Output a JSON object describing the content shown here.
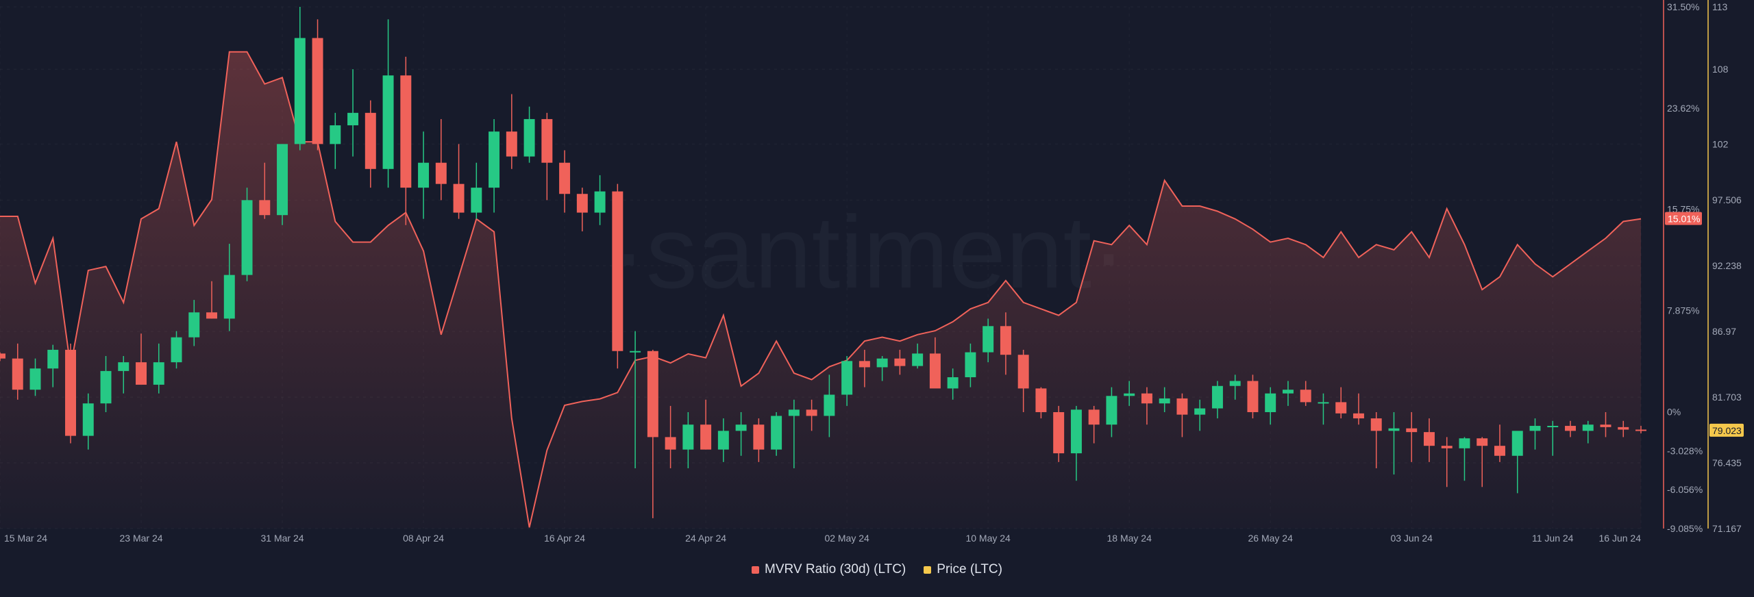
{
  "chart_data": {
    "type": "line",
    "title": "",
    "watermark": "·santiment·",
    "x_dates": [
      "15 Mar 24",
      "16 Mar 24",
      "17 Mar 24",
      "18 Mar 24",
      "19 Mar 24",
      "20 Mar 24",
      "21 Mar 24",
      "22 Mar 24",
      "23 Mar 24",
      "24 Mar 24",
      "25 Mar 24",
      "26 Mar 24",
      "27 Mar 24",
      "28 Mar 24",
      "29 Mar 24",
      "30 Mar 24",
      "31 Mar 24",
      "01 Apr 24",
      "02 Apr 24",
      "03 Apr 24",
      "04 Apr 24",
      "05 Apr 24",
      "06 Apr 24",
      "07 Apr 24",
      "08 Apr 24",
      "09 Apr 24",
      "10 Apr 24",
      "11 Apr 24",
      "12 Apr 24",
      "13 Apr 24",
      "14 Apr 24",
      "15 Apr 24",
      "16 Apr 24",
      "17 Apr 24",
      "18 Apr 24",
      "19 Apr 24",
      "20 Apr 24",
      "21 Apr 24",
      "22 Apr 24",
      "23 Apr 24",
      "24 Apr 24",
      "25 Apr 24",
      "26 Apr 24",
      "27 Apr 24",
      "28 Apr 24",
      "29 Apr 24",
      "30 Apr 24",
      "01 May 24",
      "02 May 24",
      "03 May 24",
      "04 May 24",
      "05 May 24",
      "06 May 24",
      "07 May 24",
      "08 May 24",
      "09 May 24",
      "10 May 24",
      "11 May 24",
      "12 May 24",
      "13 May 24",
      "14 May 24",
      "15 May 24",
      "16 May 24",
      "17 May 24",
      "18 May 24",
      "19 May 24",
      "20 May 24",
      "21 May 24",
      "22 May 24",
      "23 May 24",
      "24 May 24",
      "25 May 24",
      "26 May 24",
      "27 May 24",
      "28 May 24",
      "29 May 24",
      "30 May 24",
      "31 May 24",
      "01 Jun 24",
      "02 Jun 24",
      "03 Jun 24",
      "04 Jun 24",
      "05 Jun 24",
      "06 Jun 24",
      "07 Jun 24",
      "08 Jun 24",
      "09 Jun 24",
      "10 Jun 24",
      "11 Jun 24",
      "12 Jun 24",
      "13 Jun 24",
      "14 Jun 24",
      "15 Jun 24",
      "16 Jun 24"
    ],
    "x_tick_labels": [
      "15 Mar 24",
      "23 Mar 24",
      "31 Mar 24",
      "08 Apr 24",
      "16 Apr 24",
      "24 Apr 24",
      "02 May 24",
      "10 May 24",
      "18 May 24",
      "26 May 24",
      "03 Jun 24",
      "11 Jun 24",
      "16 Jun 24"
    ],
    "series": [
      {
        "name": "MVRV Ratio (30d) (LTC)",
        "color": "#f0625a",
        "axis": "left",
        "values": [
          15.2,
          15.2,
          10.0,
          13.5,
          3.5,
          11.0,
          11.3,
          8.5,
          15.0,
          15.8,
          21.0,
          14.5,
          16.5,
          28.0,
          28.0,
          25.5,
          26.0,
          21.0,
          21.0,
          14.8,
          13.2,
          13.2,
          14.5,
          15.5,
          12.5,
          6.0,
          10.5,
          15.0,
          14.0,
          -0.5,
          -9.0,
          -3.0,
          0.5,
          0.8,
          1.0,
          1.5,
          4.0,
          4.3,
          3.8,
          4.5,
          4.2,
          7.5,
          2.0,
          3.0,
          5.5,
          3.0,
          2.5,
          3.5,
          4.0,
          5.5,
          5.8,
          5.5,
          6.0,
          6.3,
          7.0,
          8.0,
          8.5,
          10.2,
          8.5,
          8.0,
          7.5,
          8.5,
          13.3,
          13.0,
          14.5,
          13.0,
          18.0,
          16.0,
          16.0,
          15.6,
          15.0,
          14.2,
          13.2,
          13.5,
          13.0,
          12.0,
          14.0,
          12.0,
          13.0,
          12.6,
          14.0,
          12.0,
          15.8,
          13.0,
          9.5,
          10.5,
          13.0,
          11.5,
          10.5,
          11.5,
          12.5,
          13.5,
          14.8,
          15.01
        ]
      },
      {
        "name": "Price (LTC)",
        "color": "#f5c84c",
        "axis": "right",
        "ohlc": [
          [
            85.2,
            85.3,
            84.6,
            84.8
          ],
          [
            84.8,
            86.0,
            81.5,
            82.3
          ],
          [
            82.3,
            84.8,
            81.8,
            84.0
          ],
          [
            84.0,
            85.9,
            82.5,
            85.5
          ],
          [
            85.5,
            86.0,
            78.0,
            78.6
          ],
          [
            78.6,
            82.0,
            77.5,
            81.2
          ],
          [
            81.2,
            85.0,
            80.5,
            83.8
          ],
          [
            83.8,
            85.0,
            82.0,
            84.5
          ],
          [
            84.5,
            86.8,
            83.0,
            82.7
          ],
          [
            82.7,
            86.0,
            82.0,
            84.5
          ],
          [
            84.5,
            87.0,
            84.0,
            86.5
          ],
          [
            86.5,
            89.5,
            85.8,
            88.5
          ],
          [
            88.5,
            91.0,
            88.0,
            88.0
          ],
          [
            88.0,
            94.0,
            87.0,
            91.5
          ],
          [
            91.5,
            98.5,
            91.0,
            97.5
          ],
          [
            97.5,
            100.5,
            96.0,
            96.3
          ],
          [
            96.3,
            99.0,
            95.5,
            102.0
          ],
          [
            102.0,
            113.0,
            101.5,
            110.5
          ],
          [
            110.5,
            112.0,
            101.5,
            102.0
          ],
          [
            102.0,
            104.5,
            100.0,
            103.5
          ],
          [
            103.5,
            108.0,
            101.0,
            104.5
          ],
          [
            104.5,
            105.5,
            98.5,
            100.0
          ],
          [
            100.0,
            112.0,
            98.5,
            107.5
          ],
          [
            107.5,
            109.0,
            95.5,
            98.5
          ],
          [
            98.5,
            103.0,
            96.0,
            100.5
          ],
          [
            100.5,
            104.0,
            97.5,
            98.8
          ],
          [
            98.8,
            102.0,
            96.0,
            96.5
          ],
          [
            96.5,
            100.5,
            96.0,
            98.5
          ],
          [
            98.5,
            104.0,
            96.5,
            103.0
          ],
          [
            103.0,
            106.0,
            100.0,
            101.0
          ],
          [
            101.0,
            105.0,
            100.5,
            104.0
          ],
          [
            104.0,
            104.5,
            97.5,
            100.5
          ],
          [
            100.5,
            101.5,
            96.5,
            98.0
          ],
          [
            98.0,
            98.5,
            95.0,
            96.5
          ],
          [
            96.5,
            99.5,
            95.5,
            98.2
          ],
          [
            98.2,
            98.8,
            84.0,
            85.4
          ],
          [
            85.4,
            87.0,
            76.0,
            85.4
          ],
          [
            85.4,
            85.5,
            72.0,
            78.5
          ],
          [
            78.5,
            81.0,
            76.0,
            77.5
          ],
          [
            77.5,
            80.5,
            76.0,
            79.5
          ],
          [
            79.5,
            81.5,
            77.5,
            77.5
          ],
          [
            77.5,
            80.0,
            76.5,
            79.0
          ],
          [
            79.0,
            80.5,
            77.0,
            79.5
          ],
          [
            79.5,
            80.0,
            76.5,
            77.5
          ],
          [
            77.5,
            80.5,
            77.0,
            80.2
          ],
          [
            80.2,
            81.5,
            76.0,
            80.7
          ],
          [
            80.7,
            81.5,
            79.0,
            80.2
          ],
          [
            80.2,
            83.5,
            78.5,
            81.9
          ],
          [
            81.9,
            85.0,
            81.0,
            84.6
          ],
          [
            84.6,
            85.5,
            82.5,
            84.1
          ],
          [
            84.1,
            85.0,
            83.0,
            84.8
          ],
          [
            84.8,
            85.5,
            83.5,
            84.2
          ],
          [
            84.2,
            86.0,
            84.0,
            85.2
          ],
          [
            85.2,
            86.5,
            84.5,
            82.4
          ],
          [
            82.4,
            84.0,
            81.5,
            83.3
          ],
          [
            83.3,
            86.0,
            82.5,
            85.3
          ],
          [
            85.3,
            88.0,
            84.5,
            87.4
          ],
          [
            87.4,
            88.5,
            83.5,
            85.1
          ],
          [
            85.1,
            85.5,
            80.5,
            82.4
          ],
          [
            82.4,
            82.5,
            80.0,
            80.5
          ],
          [
            80.5,
            81.0,
            76.5,
            77.2
          ],
          [
            77.2,
            81.0,
            75.0,
            80.7
          ],
          [
            80.7,
            81.0,
            78.0,
            79.5
          ],
          [
            79.5,
            82.5,
            78.5,
            81.8
          ],
          [
            81.8,
            83.0,
            81.0,
            82.0
          ],
          [
            82.0,
            82.5,
            79.5,
            81.2
          ],
          [
            81.2,
            82.5,
            80.5,
            81.6
          ],
          [
            81.6,
            82.0,
            78.5,
            80.3
          ],
          [
            80.3,
            81.5,
            79.0,
            80.8
          ],
          [
            80.8,
            83.0,
            80.0,
            82.6
          ],
          [
            82.6,
            83.5,
            81.5,
            83.0
          ],
          [
            83.0,
            83.5,
            80.0,
            80.5
          ],
          [
            80.5,
            82.5,
            79.5,
            82.0
          ],
          [
            82.0,
            83.0,
            81.0,
            82.3
          ],
          [
            82.3,
            83.0,
            81.0,
            81.3
          ],
          [
            81.3,
            82.0,
            79.5,
            81.3
          ],
          [
            81.3,
            82.5,
            80.0,
            80.4
          ],
          [
            80.4,
            82.0,
            79.5,
            80.0
          ],
          [
            80.0,
            80.5,
            76.0,
            79.0
          ],
          [
            79.0,
            80.5,
            75.5,
            79.2
          ],
          [
            79.2,
            80.5,
            76.5,
            78.9
          ],
          [
            78.9,
            80.0,
            76.5,
            77.8
          ],
          [
            77.8,
            78.5,
            74.5,
            77.6
          ],
          [
            77.6,
            78.5,
            75.0,
            78.4
          ],
          [
            78.4,
            78.5,
            74.5,
            77.8
          ],
          [
            77.8,
            79.5,
            76.5,
            77.0
          ],
          [
            77.0,
            78.0,
            74.0,
            79.0
          ],
          [
            79.0,
            80.0,
            77.5,
            79.4
          ],
          [
            79.4,
            79.8,
            77.0,
            79.4
          ],
          [
            79.4,
            79.8,
            78.5,
            79.0
          ],
          [
            79.0,
            79.8,
            78.0,
            79.5
          ],
          [
            79.5,
            80.5,
            78.5,
            79.3
          ],
          [
            79.3,
            79.8,
            78.5,
            79.1
          ],
          [
            79.1,
            79.4,
            78.8,
            79.023
          ]
        ]
      }
    ],
    "left_axis": {
      "ylim": [
        -9.085,
        31.5
      ],
      "ticks": [
        "31.50%",
        "23.62%",
        "15.75%",
        "7.875%",
        "0%",
        "-3.028%",
        "-6.056%",
        "-9.085%"
      ],
      "current_label": "15.01%"
    },
    "right_axis": {
      "ylim": [
        71.167,
        113
      ],
      "ticks": [
        "113",
        "108",
        "102",
        "97.506",
        "92.238",
        "86.97",
        "81.703",
        "76.435",
        "71.167"
      ],
      "current_label": "79.023"
    },
    "grid": true,
    "legend_position": "bottom-center"
  },
  "legend": {
    "mvrv_label": "MVRV Ratio (30d) (LTC)",
    "price_label": "Price (LTC)"
  },
  "colors": {
    "background": "#171b2b",
    "mvrv": "#f0625a",
    "price_axis": "#f5c84c",
    "candle_up": "#26c985",
    "candle_down": "#f0625a",
    "text": "#a3a9b8"
  }
}
